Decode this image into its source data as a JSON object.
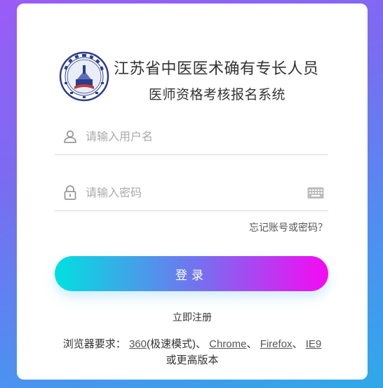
{
  "header": {
    "title_line1": "江苏省中医医术确有专长人员",
    "title_line2": "医师资格考核报名系统"
  },
  "form": {
    "username_placeholder": "请输入用户名",
    "password_placeholder": "请输入密码",
    "forgot_link": "忘记账号或密码？",
    "login_button": "登录",
    "register_link": "立即注册"
  },
  "browser_requirements": {
    "prefix": "浏览器要求：",
    "link_360": "360",
    "mode_360": "(极速模式)、",
    "link_chrome": "Chrome",
    "sep_chrome": "、",
    "link_firefox": "Firefox",
    "sep_firefox": "、",
    "link_ie9": "IE9",
    "suffix": "或更高版本"
  },
  "colors": {
    "button_gradient_start": "#00e0e0",
    "button_gradient_end": "#f50af2",
    "icon_gray": "#999999"
  },
  "icons": {
    "user": "user-icon",
    "lock": "lock-icon",
    "keyboard": "keyboard-icon",
    "logo": "association-seal-logo"
  }
}
